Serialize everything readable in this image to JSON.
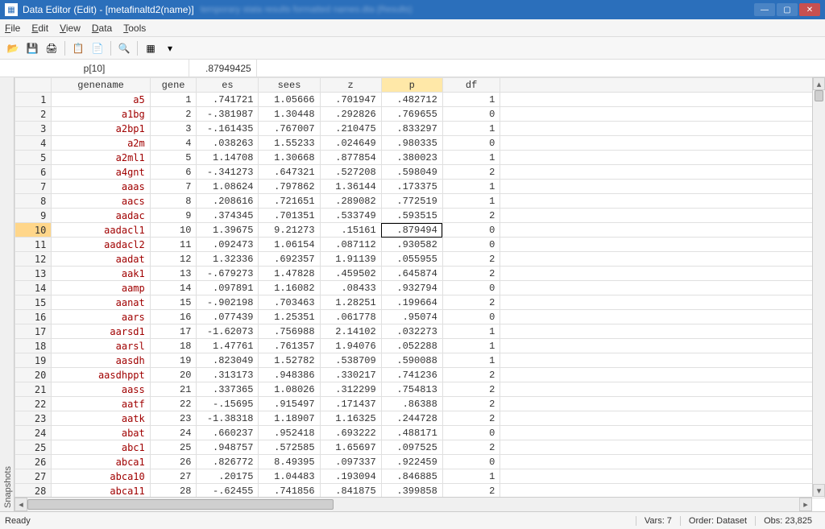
{
  "window": {
    "title": "Data Editor (Edit) - [metafinaltd2(name)]",
    "blurred": "temporary stata results formatted names.dta (Results)"
  },
  "menus": [
    "File",
    "Edit",
    "View",
    "Data",
    "Tools"
  ],
  "toolbar_icons": [
    "open-icon",
    "save-icon",
    "print-icon",
    "copy-icon",
    "paste-icon",
    "browse-icon",
    "filter-icon",
    "dropdown-icon"
  ],
  "toolbar_glyphs": [
    "📂",
    "💾",
    "🖨",
    "📋",
    "📄",
    "🔍",
    "▦",
    "▾"
  ],
  "cellref": "p[10]",
  "cellval": ".87949425",
  "snapshots_label": "Snapshots",
  "columns": [
    "genename",
    "gene",
    "es",
    "sees",
    "z",
    "p",
    "df"
  ],
  "selected_col_index": 5,
  "selected_row_index": 9,
  "rows": [
    {
      "n": 1,
      "genename": "a5",
      "gene": 1,
      "es": ".741721",
      "sees": "1.05666",
      "z": ".701947",
      "p": ".482712",
      "df": 1
    },
    {
      "n": 2,
      "genename": "a1bg",
      "gene": 2,
      "es": "-.381987",
      "sees": "1.30448",
      "z": ".292826",
      "p": ".769655",
      "df": 0
    },
    {
      "n": 3,
      "genename": "a2bp1",
      "gene": 3,
      "es": "-.161435",
      "sees": ".767007",
      "z": ".210475",
      "p": ".833297",
      "df": 1
    },
    {
      "n": 4,
      "genename": "a2m",
      "gene": 4,
      "es": ".038263",
      "sees": "1.55233",
      "z": ".024649",
      "p": ".980335",
      "df": 0
    },
    {
      "n": 5,
      "genename": "a2ml1",
      "gene": 5,
      "es": "1.14708",
      "sees": "1.30668",
      "z": ".877854",
      "p": ".380023",
      "df": 1
    },
    {
      "n": 6,
      "genename": "a4gnt",
      "gene": 6,
      "es": "-.341273",
      "sees": ".647321",
      "z": ".527208",
      "p": ".598049",
      "df": 2
    },
    {
      "n": 7,
      "genename": "aaas",
      "gene": 7,
      "es": "1.08624",
      "sees": ".797862",
      "z": "1.36144",
      "p": ".173375",
      "df": 1
    },
    {
      "n": 8,
      "genename": "aacs",
      "gene": 8,
      "es": ".208616",
      "sees": ".721651",
      "z": ".289082",
      "p": ".772519",
      "df": 1
    },
    {
      "n": 9,
      "genename": "aadac",
      "gene": 9,
      "es": ".374345",
      "sees": ".701351",
      "z": ".533749",
      "p": ".593515",
      "df": 2
    },
    {
      "n": 10,
      "genename": "aadacl1",
      "gene": 10,
      "es": "1.39675",
      "sees": "9.21273",
      "z": ".15161",
      "p": ".879494",
      "df": 0
    },
    {
      "n": 11,
      "genename": "aadacl2",
      "gene": 11,
      "es": ".092473",
      "sees": "1.06154",
      "z": ".087112",
      "p": ".930582",
      "df": 0
    },
    {
      "n": 12,
      "genename": "aadat",
      "gene": 12,
      "es": "1.32336",
      "sees": ".692357",
      "z": "1.91139",
      "p": ".055955",
      "df": 2
    },
    {
      "n": 13,
      "genename": "aak1",
      "gene": 13,
      "es": "-.679273",
      "sees": "1.47828",
      "z": ".459502",
      "p": ".645874",
      "df": 2
    },
    {
      "n": 14,
      "genename": "aamp",
      "gene": 14,
      "es": ".097891",
      "sees": "1.16082",
      "z": ".08433",
      "p": ".932794",
      "df": 0
    },
    {
      "n": 15,
      "genename": "aanat",
      "gene": 15,
      "es": "-.902198",
      "sees": ".703463",
      "z": "1.28251",
      "p": ".199664",
      "df": 2
    },
    {
      "n": 16,
      "genename": "aars",
      "gene": 16,
      "es": ".077439",
      "sees": "1.25351",
      "z": ".061778",
      "p": ".95074",
      "df": 0
    },
    {
      "n": 17,
      "genename": "aarsd1",
      "gene": 17,
      "es": "-1.62073",
      "sees": ".756988",
      "z": "2.14102",
      "p": ".032273",
      "df": 1
    },
    {
      "n": 18,
      "genename": "aarsl",
      "gene": 18,
      "es": "1.47761",
      "sees": ".761357",
      "z": "1.94076",
      "p": ".052288",
      "df": 1
    },
    {
      "n": 19,
      "genename": "aasdh",
      "gene": 19,
      "es": ".823049",
      "sees": "1.52782",
      "z": ".538709",
      "p": ".590088",
      "df": 1
    },
    {
      "n": 20,
      "genename": "aasdhppt",
      "gene": 20,
      "es": ".313173",
      "sees": ".948386",
      "z": ".330217",
      "p": ".741236",
      "df": 2
    },
    {
      "n": 21,
      "genename": "aass",
      "gene": 21,
      "es": ".337365",
      "sees": "1.08026",
      "z": ".312299",
      "p": ".754813",
      "df": 2
    },
    {
      "n": 22,
      "genename": "aatf",
      "gene": 22,
      "es": "-.15695",
      "sees": ".915497",
      "z": ".171437",
      "p": ".86388",
      "df": 2
    },
    {
      "n": 23,
      "genename": "aatk",
      "gene": 23,
      "es": "-1.38318",
      "sees": "1.18907",
      "z": "1.16325",
      "p": ".244728",
      "df": 2
    },
    {
      "n": 24,
      "genename": "abat",
      "gene": 24,
      "es": ".660237",
      "sees": ".952418",
      "z": ".693222",
      "p": ".488171",
      "df": 0
    },
    {
      "n": 25,
      "genename": "abc1",
      "gene": 25,
      "es": ".948757",
      "sees": ".572585",
      "z": "1.65697",
      "p": ".097525",
      "df": 2
    },
    {
      "n": 26,
      "genename": "abca1",
      "gene": 26,
      "es": ".826772",
      "sees": "8.49395",
      "z": ".097337",
      "p": ".922459",
      "df": 0
    },
    {
      "n": 27,
      "genename": "abca10",
      "gene": 27,
      "es": ".20175",
      "sees": "1.04483",
      "z": ".193094",
      "p": ".846885",
      "df": 1
    },
    {
      "n": 28,
      "genename": "abca11",
      "gene": 28,
      "es": "-.62455",
      "sees": ".741856",
      "z": ".841875",
      "p": ".399858",
      "df": 2
    }
  ],
  "status": {
    "ready": "Ready",
    "vars": "Vars: 7",
    "order": "Order: Dataset",
    "obs": "Obs: 23,825"
  }
}
